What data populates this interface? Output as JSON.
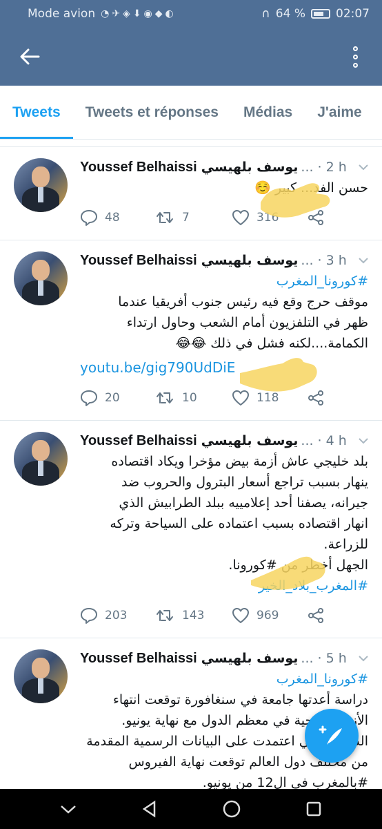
{
  "status_bar": {
    "left_text": "Mode avion",
    "battery_text": "64 %",
    "time": "02:07"
  },
  "header": {
    "back_icon": "arrow-left-icon",
    "menu_icon": "more-vertical-icon"
  },
  "tabs": [
    {
      "label": "Tweets",
      "active": true
    },
    {
      "label": "Tweets et réponses",
      "active": false
    },
    {
      "label": "Médias",
      "active": false
    },
    {
      "label": "J'aime",
      "active": false
    }
  ],
  "colors": {
    "header_bg": "#4f6f96",
    "accent": "#1da1f2",
    "link": "#1b95e0",
    "muted": "#657786",
    "highlight_hand": "#f7d560"
  },
  "tweets": [
    {
      "name": "Youssef Belhaissi",
      "handle": "يوسف بلهيسي",
      "ellipsis": "...",
      "time": "· 2 h",
      "lines": [
        "حسن الفد... كبير ☺️"
      ],
      "hashtag": "",
      "link": "",
      "hashtag_bottom": "",
      "counts": {
        "reply": "48",
        "retweet": "7",
        "like": "316"
      }
    },
    {
      "name": "Youssef Belhaissi",
      "handle": "يوسف بلهيسي",
      "ellipsis": "...",
      "time": "· 3 h",
      "hashtag": "#كورونا_المغرب",
      "lines": [
        "موقف حرج وقع فيه رئيس جنوب أفريقيا عندما",
        "ظهر في التلفزيون أمام الشعب وحاول ارتداء",
        "الكمامة....لكنه فشل في ذلك 😂😂"
      ],
      "link": "youtu.be/gig790UdDiE",
      "hashtag_bottom": "",
      "counts": {
        "reply": "20",
        "retweet": "10",
        "like": "118"
      }
    },
    {
      "name": "Youssef Belhaissi",
      "handle": "يوسف بلهيسي",
      "ellipsis": "...",
      "time": "· 4 h",
      "hashtag": "",
      "lines": [
        "بلد خليجي عاش أزمة بيض مؤخرا ويكاد اقتصاده",
        "ينهار بسبب تراجع أسعار البترول والحروب ضد",
        "جيرانه، يصفنا أحد إعلامييه ببلد الطرابيش الذي",
        "انهار اقتصاده بسبب اعتماده على السياحة وتركه",
        "للزراعة.",
        "الجهل أخطر من #كورونا."
      ],
      "link": "",
      "hashtag_bottom": "#المغرب_بلاد_الخير",
      "counts": {
        "reply": "203",
        "retweet": "143",
        "like": "969"
      }
    },
    {
      "name": "Youssef Belhaissi",
      "handle": "يوسف بلهيسي",
      "ellipsis": "...",
      "time": "· 5 h",
      "hashtag": "#كورونا_المغرب",
      "lines": [
        "دراسة أعدتها جامعة في سنغافورة توقعت انتهاء",
        "الأزمة الصحية في معظم الدول مع نهاية يونيو.",
        "الدراسة التي اعتمدت على البيانات الرسمية المقدمة",
        "من مختلف دول العالم توقعت نهاية الفيروس",
        "#بالمغرب في ال12 من يونيو."
      ],
      "link": "",
      "hashtag_bottom": "",
      "counts": {
        "reply": "",
        "retweet": "",
        "like": ""
      }
    }
  ]
}
